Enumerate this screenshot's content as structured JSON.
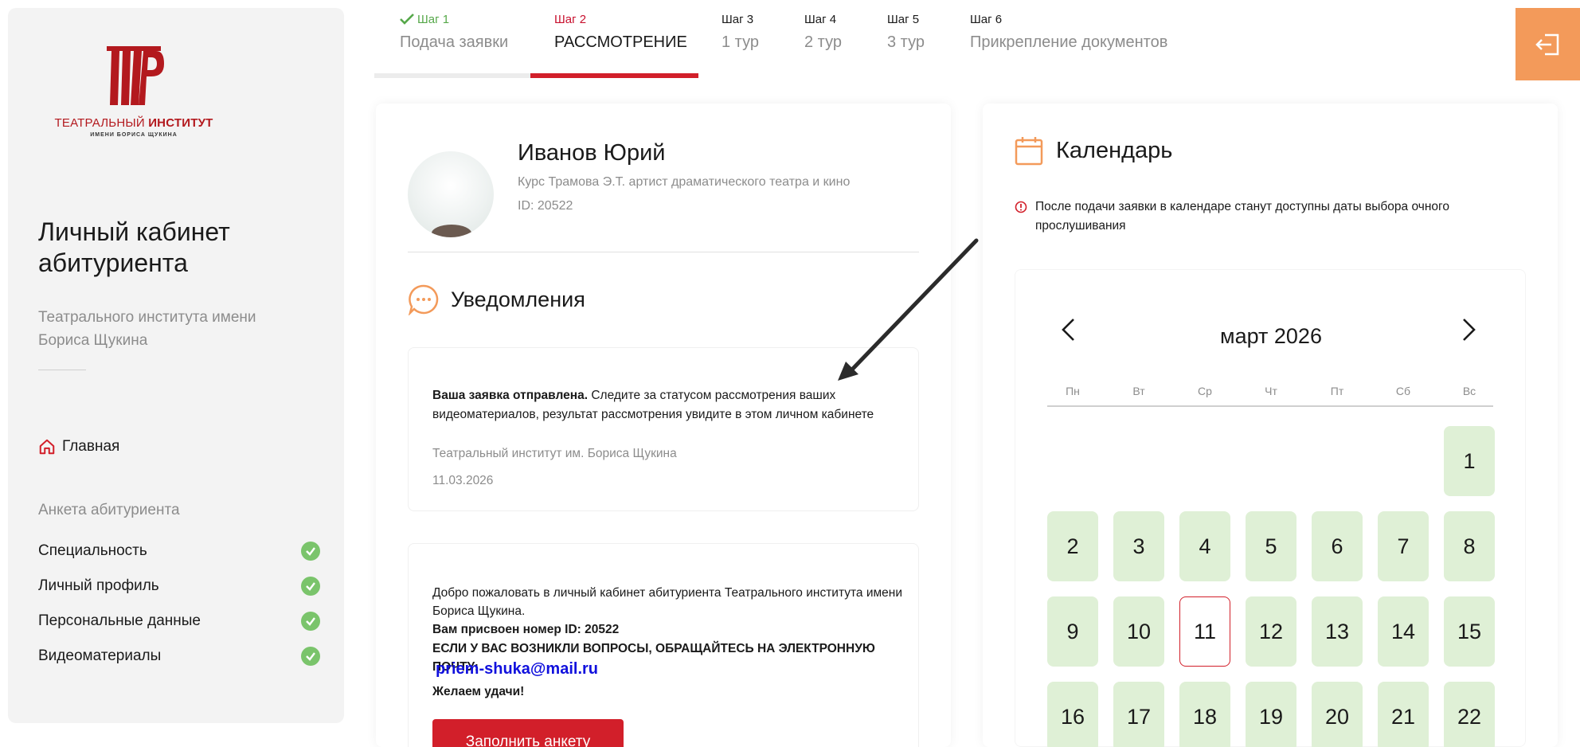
{
  "sidebar": {
    "logo": {
      "line1_regular": "ТЕАТРАЛЬНЫЙ ",
      "line1_bold": "ИНСТИТУТ",
      "line2": "ИМЕНИ БОРИСА ЩУКИНА",
      "color": "#b3191e"
    },
    "title": "Личный кабинет абитуриента",
    "subtitle": "Театрального института имени Бориса Щукина",
    "home_label": "Главная",
    "section_label": "Анкета абитуриента",
    "items": [
      {
        "label": "Специальность",
        "status": "done"
      },
      {
        "label": "Личный профиль",
        "status": "done"
      },
      {
        "label": "Персональные данные",
        "status": "done"
      },
      {
        "label": "Видеоматериалы",
        "status": "done"
      }
    ]
  },
  "steps": [
    {
      "num": "Шаг 1",
      "name": "Подача заявки",
      "state": "done"
    },
    {
      "num": "Шаг 2",
      "name": "РАССМОТРЕНИЕ",
      "state": "active"
    },
    {
      "num": "Шаг 3",
      "name": "1 тур",
      "state": "pending"
    },
    {
      "num": "Шаг 4",
      "name": "2 тур",
      "state": "pending"
    },
    {
      "num": "Шаг 5",
      "name": "3 тур",
      "state": "pending"
    },
    {
      "num": "Шаг 6",
      "name": "Прикрепление документов",
      "state": "pending"
    }
  ],
  "profile": {
    "name": "Иванов Юрий",
    "course": "Курс Трамова Э.Т. артист драматического театра и кино",
    "id": "ID: 20522"
  },
  "notifications": {
    "title": "Уведомления",
    "n1": {
      "bold": "Ваша заявка отправлена.",
      "text": " Следите за статусом рассмотрения ваших видеоматериалов, результат рассмотрения увидите в этом личном кабинете",
      "source": "Театральный институт им. Бориса Щукина",
      "date": "11.03.2026"
    },
    "n2": {
      "welcome": "Добро пожаловать в личный кабинет абитуриента Театрального института имени Бориса Щукина.",
      "id_line": "Вам присвоен номер ID: 20522",
      "questions": "ЕСЛИ У ВАС ВОЗНИКЛИ ВОПРОСЫ, ОБРАЩАЙТЕСЬ НА ЭЛЕКТРОННУЮ ПОЧТУ:",
      "email": "priem-shuka@mail.ru",
      "wish": "Желаем удачи!",
      "button": "Заполнить анкету"
    }
  },
  "calendar": {
    "title": "Календарь",
    "note": "После подачи заявки в календаре станут доступны даты выбора очного прослушивания",
    "month": "март 2026",
    "weekdays": [
      "Пн",
      "Вт",
      "Ср",
      "Чт",
      "Пт",
      "Сб",
      "Вс"
    ],
    "first_weekday_index": 6,
    "days": [
      "1",
      "2",
      "3",
      "4",
      "5",
      "6",
      "7",
      "8",
      "9",
      "10",
      "11",
      "12",
      "13",
      "14",
      "15",
      "16",
      "17",
      "18",
      "19",
      "20",
      "21",
      "22"
    ],
    "today": "11"
  },
  "colors": {
    "accent_red": "#d21f2a",
    "done_green": "#7ac46b",
    "day_green": "#dff0d6",
    "exit_orange": "#f39a5a",
    "icon_orange": "#f39a5a",
    "link_blue": "#1010dd"
  },
  "icons": {
    "exit": "logout-icon",
    "home": "home-icon",
    "check": "check-icon",
    "notifications": "chat-bubble-icon",
    "calendar": "calendar-icon",
    "warning": "alert-circle-icon"
  }
}
